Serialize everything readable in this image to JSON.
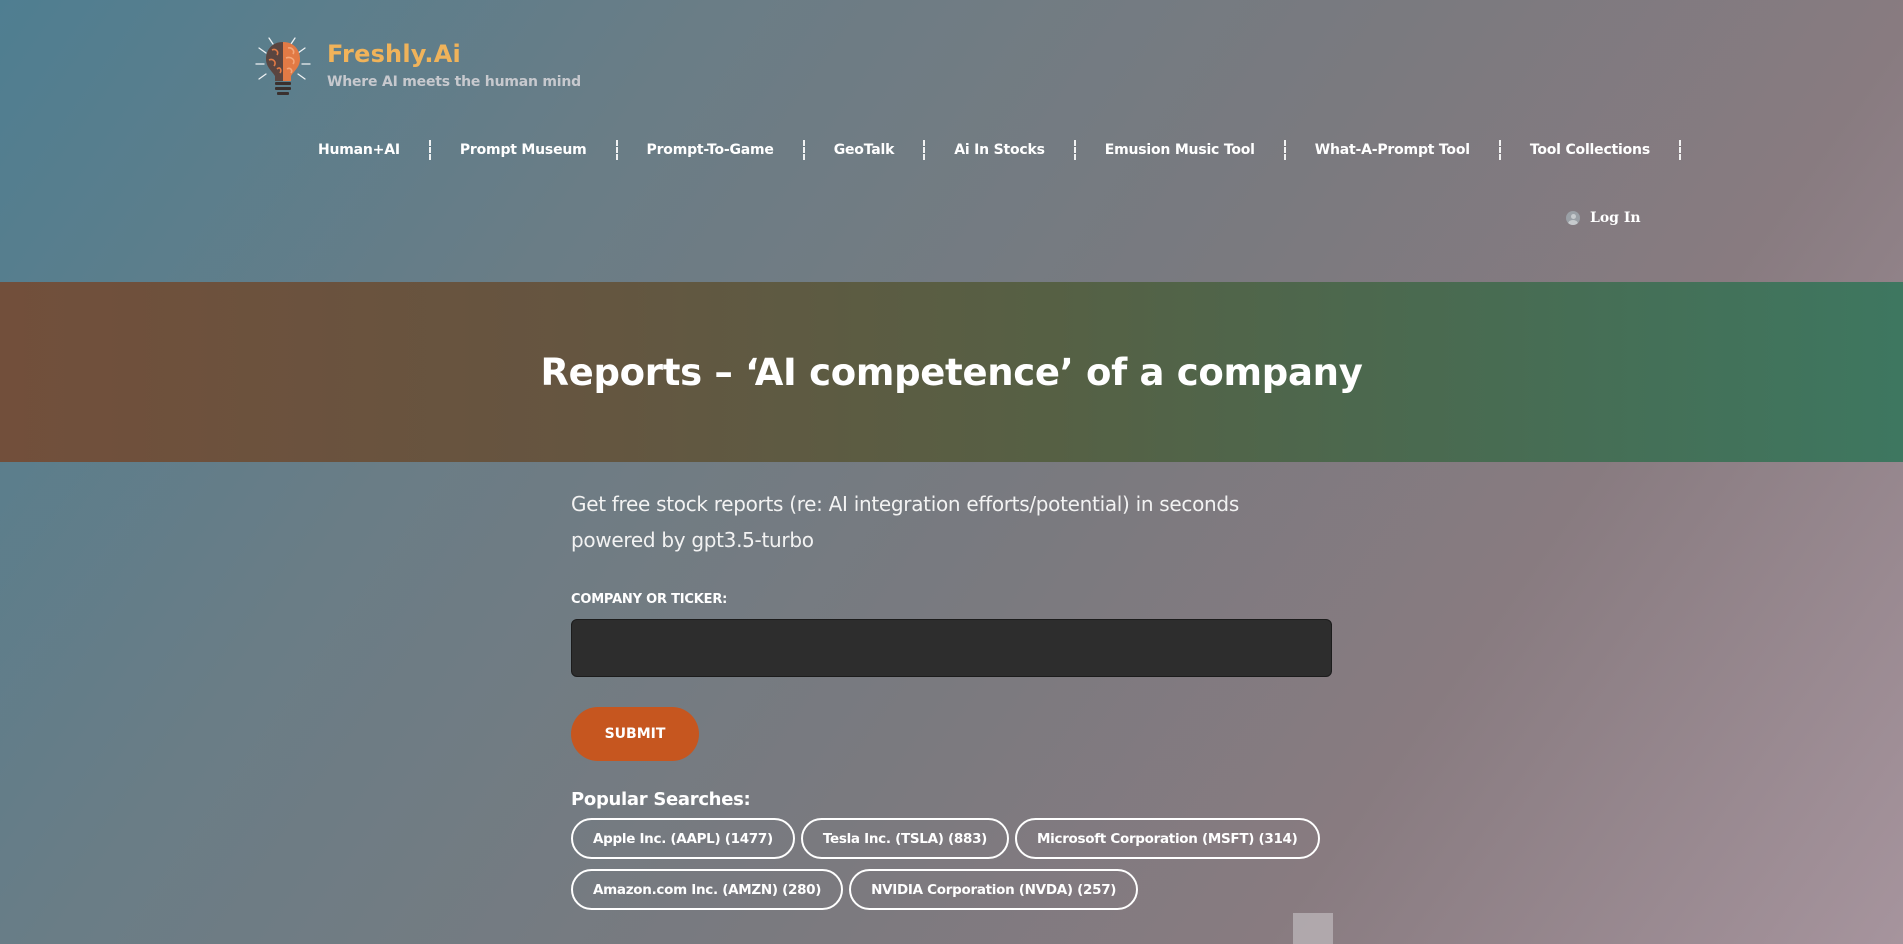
{
  "brand": {
    "name": "Freshly.Ai",
    "tagline": "Where AI meets the human mind",
    "logo_icon": "lightbulb-brain-icon"
  },
  "nav": {
    "items": [
      {
        "label": "Human+AI"
      },
      {
        "label": "Prompt Museum"
      },
      {
        "label": "Prompt-To-Game"
      },
      {
        "label": "GeoTalk"
      },
      {
        "label": "Ai In Stocks"
      },
      {
        "label": "Emusion Music Tool"
      },
      {
        "label": "What-A-Prompt Tool"
      },
      {
        "label": "Tool Collections"
      }
    ]
  },
  "login": {
    "label": "Log In",
    "icon": "user-icon"
  },
  "banner": {
    "title": "Reports – ‘AI competence’ of a company"
  },
  "main": {
    "intro": "Get free stock reports (re: AI integration efforts/potential) in seconds powered by gpt3.5-turbo",
    "field_label": "COMPANY OR TICKER:",
    "input_value": "",
    "submit_label": "SUBMIT",
    "popular_title": "Popular Searches:",
    "popular": [
      {
        "label": "Apple Inc. (AAPL) (1477)"
      },
      {
        "label": "Tesla Inc. (TSLA) (883)"
      },
      {
        "label": "Microsoft Corporation (MSFT) (314)"
      },
      {
        "label": "Amazon.com Inc. (AMZN) (280)"
      },
      {
        "label": "NVIDIA Corporation (NVDA) (257)"
      }
    ]
  },
  "colors": {
    "accent": "#c6561f",
    "brand": "#f0b35a",
    "input_bg": "#2d2d2d"
  }
}
